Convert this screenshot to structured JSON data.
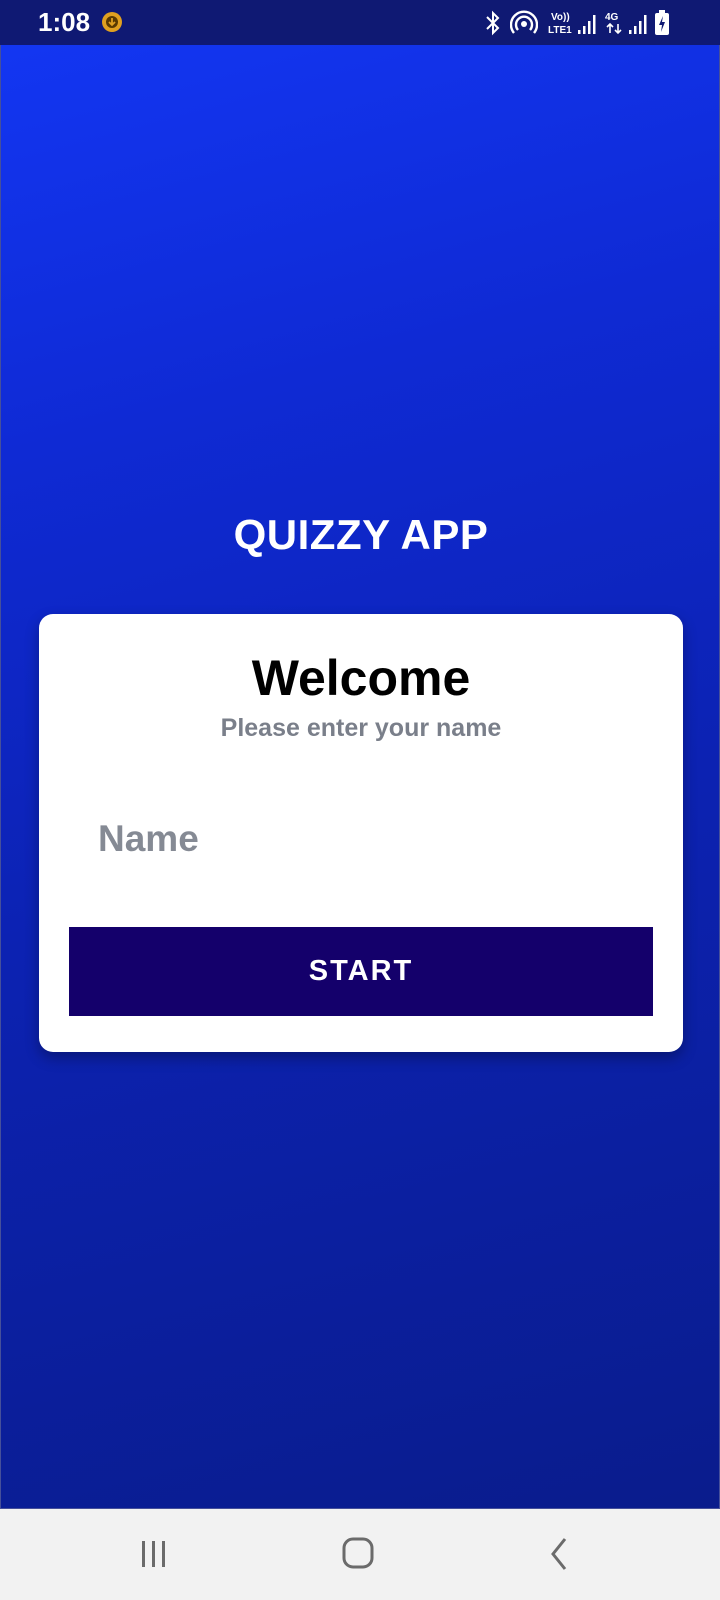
{
  "status_bar": {
    "time": "1:08",
    "icons": [
      "download-icon",
      "bluetooth-icon",
      "hotspot-icon",
      "volte-icon",
      "signal-icon",
      "4g-icon",
      "signal-icon",
      "battery-icon"
    ],
    "lte_label": "LTE1",
    "volte_label": "Vo))",
    "network_label": "4G"
  },
  "app": {
    "title": "QUIZZY APP"
  },
  "card": {
    "heading": "Welcome",
    "subtitle": "Please enter your name",
    "name_field": {
      "placeholder": "Name",
      "value": ""
    },
    "start_label": "START"
  },
  "nav_bar": {
    "items": [
      "recents-icon",
      "home-icon",
      "back-icon"
    ]
  },
  "colors": {
    "status_bar": "#0f1973",
    "gradient_top": "#1336f2",
    "gradient_bottom": "#0a1c8c",
    "button": "#14006b",
    "subtitle": "#7a7f8a"
  }
}
